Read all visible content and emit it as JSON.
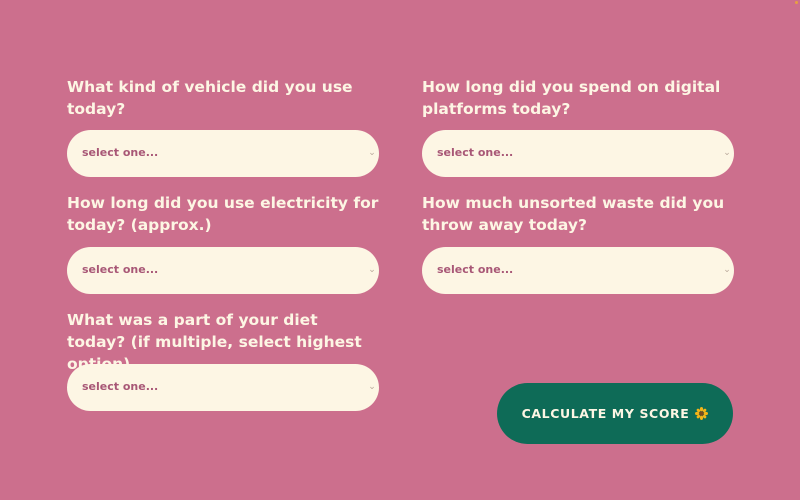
{
  "questions": [
    {
      "id": "vehicle",
      "label": "What kind of vehicle did you use today?",
      "placeholder": "select one..."
    },
    {
      "id": "digital",
      "label": "How long did you spend on digital platforms today?",
      "placeholder": "select one..."
    },
    {
      "id": "electricity",
      "label": "How long did you use electricity for today? (approx.)",
      "placeholder": "select one..."
    },
    {
      "id": "waste",
      "label": "How much unsorted waste did you throw away today?",
      "placeholder": "select one..."
    },
    {
      "id": "diet",
      "label": "What was a part of your diet today? (if multiple, select highest option)",
      "placeholder": "select one..."
    }
  ],
  "submit": {
    "label": "CALCULATE MY SCORE",
    "icon": "sunflower-icon"
  },
  "colors": {
    "background": "#cc6f8d",
    "field": "#fdf6e4",
    "field_text": "#a85776",
    "button": "#0e6b57",
    "button_text": "#fdf6e4",
    "icon_petals": "#f2b418"
  }
}
